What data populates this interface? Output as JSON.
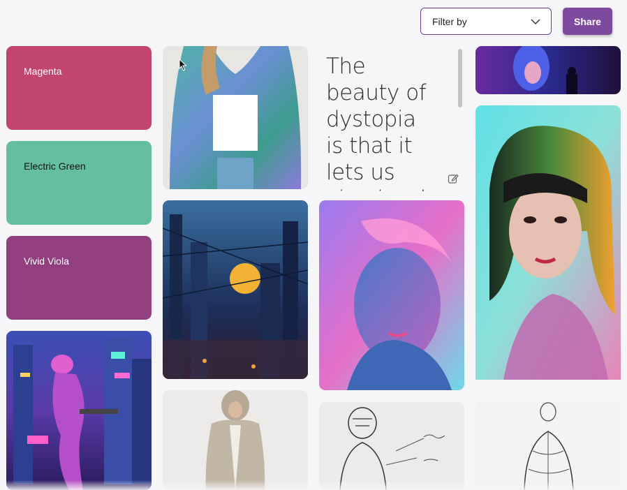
{
  "toolbar": {
    "filter_label": "Filter by",
    "filter_icon": "chevron-down-icon",
    "share_label": "Share",
    "share_color": "#7d4a9e"
  },
  "swatches": [
    {
      "label": "Magenta",
      "color": "#c24470"
    },
    {
      "label": "Electric Green",
      "color": "#64bfa2"
    },
    {
      "label": "Vivid Viola",
      "color": "#913f7f"
    }
  ],
  "quote": {
    "text": "The beauty of dystopia is that it lets us vicariously",
    "edit_icon": "edit-icon"
  }
}
